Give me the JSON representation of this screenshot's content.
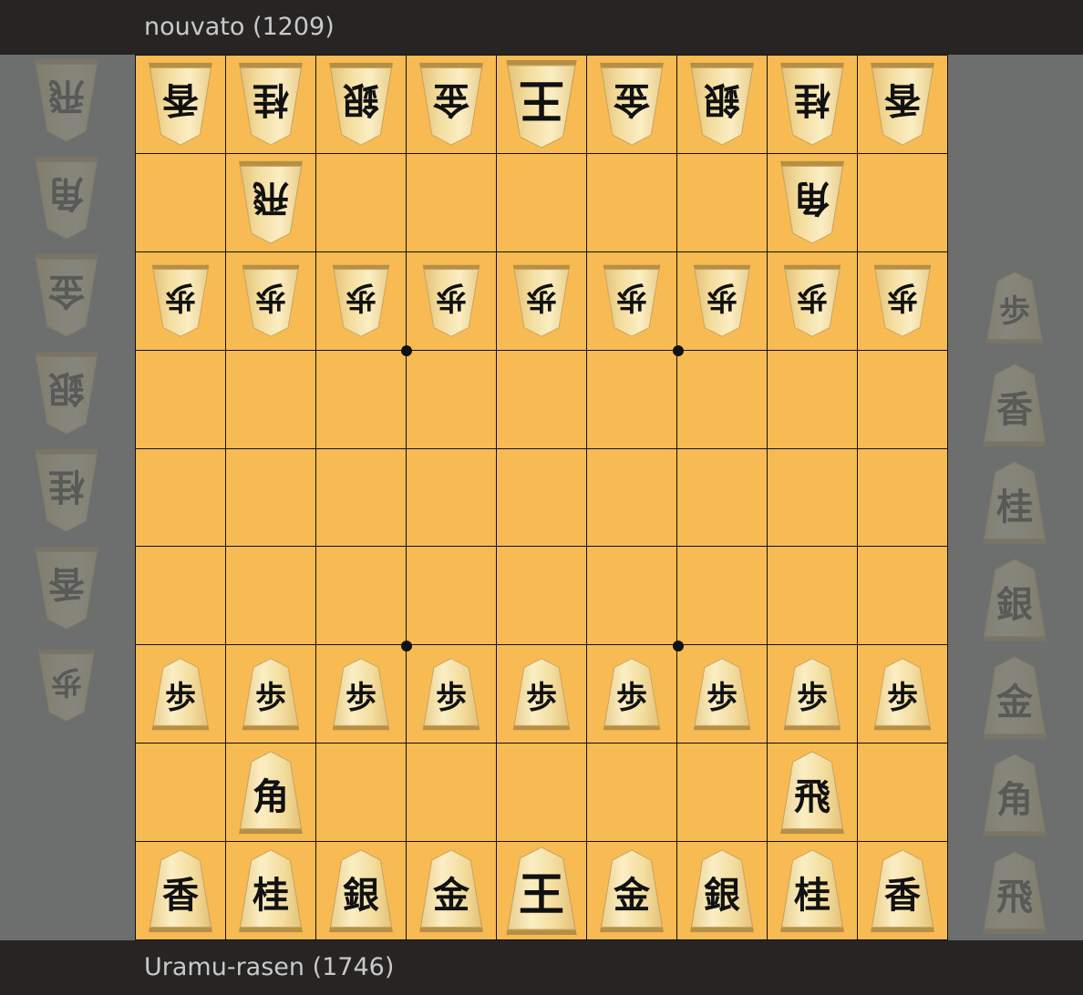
{
  "players": {
    "top": "nouvato (1209)",
    "bottom": "Uramu-rasen (1746)"
  },
  "colors": {
    "board": "#f8bb53",
    "grid": "#111111",
    "bar": "#262524",
    "sidebar": "#6c6f6d"
  },
  "board": [
    [
      "g:香",
      "g:桂",
      "g:銀",
      "g:金",
      "g:王",
      "g:金",
      "g:銀",
      "g:桂",
      "g:香"
    ],
    [
      "",
      "g:飛",
      "",
      "",
      "",
      "",
      "",
      "g:角",
      ""
    ],
    [
      "g:歩",
      "g:歩",
      "g:歩",
      "g:歩",
      "g:歩",
      "g:歩",
      "g:歩",
      "g:歩",
      "g:歩"
    ],
    [
      "",
      "",
      "",
      "",
      "",
      "",
      "",
      "",
      ""
    ],
    [
      "",
      "",
      "",
      "",
      "",
      "",
      "",
      "",
      ""
    ],
    [
      "",
      "",
      "",
      "",
      "",
      "",
      "",
      "",
      ""
    ],
    [
      "s:歩",
      "s:歩",
      "s:歩",
      "s:歩",
      "s:歩",
      "s:歩",
      "s:歩",
      "s:歩",
      "s:歩"
    ],
    [
      "",
      "s:角",
      "",
      "",
      "",
      "",
      "",
      "s:飛",
      ""
    ],
    [
      "s:香",
      "s:桂",
      "s:銀",
      "s:金",
      "s:王",
      "s:金",
      "s:銀",
      "s:桂",
      "s:香"
    ]
  ],
  "hand_left": [
    "飛",
    "角",
    "金",
    "銀",
    "桂",
    "香",
    "歩"
  ],
  "hand_right": [
    "歩",
    "香",
    "桂",
    "銀",
    "金",
    "角",
    "飛"
  ]
}
